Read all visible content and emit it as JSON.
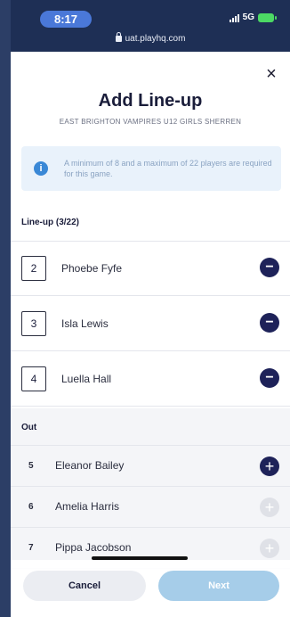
{
  "status_bar": {
    "time": "8:17",
    "network": "5G"
  },
  "browser": {
    "url": "uat.playhq.com"
  },
  "modal": {
    "close_symbol": "×",
    "title": "Add Line-up",
    "subtitle": "EAST BRIGHTON VAMPIRES U12 GIRLS SHERREN",
    "info": {
      "icon": "i",
      "text": "A minimum of 8 and a maximum of 22 players are required for this game."
    },
    "lineup": {
      "label": "Line-up (3/22)",
      "players": [
        {
          "number": "2",
          "name": "Phoebe Fyfe",
          "action": "−"
        },
        {
          "number": "3",
          "name": "Isla Lewis",
          "action": "−"
        },
        {
          "number": "4",
          "name": "Luella Hall",
          "action": "−"
        }
      ]
    },
    "out": {
      "label": "Out",
      "players": [
        {
          "number": "5",
          "name": "Eleanor Bailey",
          "action": "+"
        },
        {
          "number": "6",
          "name": "Amelia Harris",
          "action": "+"
        },
        {
          "number": "7",
          "name": "Pippa Jacobson",
          "action": "+"
        }
      ]
    },
    "footer": {
      "cancel_label": "Cancel",
      "next_label": "Next"
    }
  },
  "colors": {
    "primary": "#1e2259",
    "info_bg": "#e9f2fb",
    "next_disabled": "#a6cde9"
  }
}
